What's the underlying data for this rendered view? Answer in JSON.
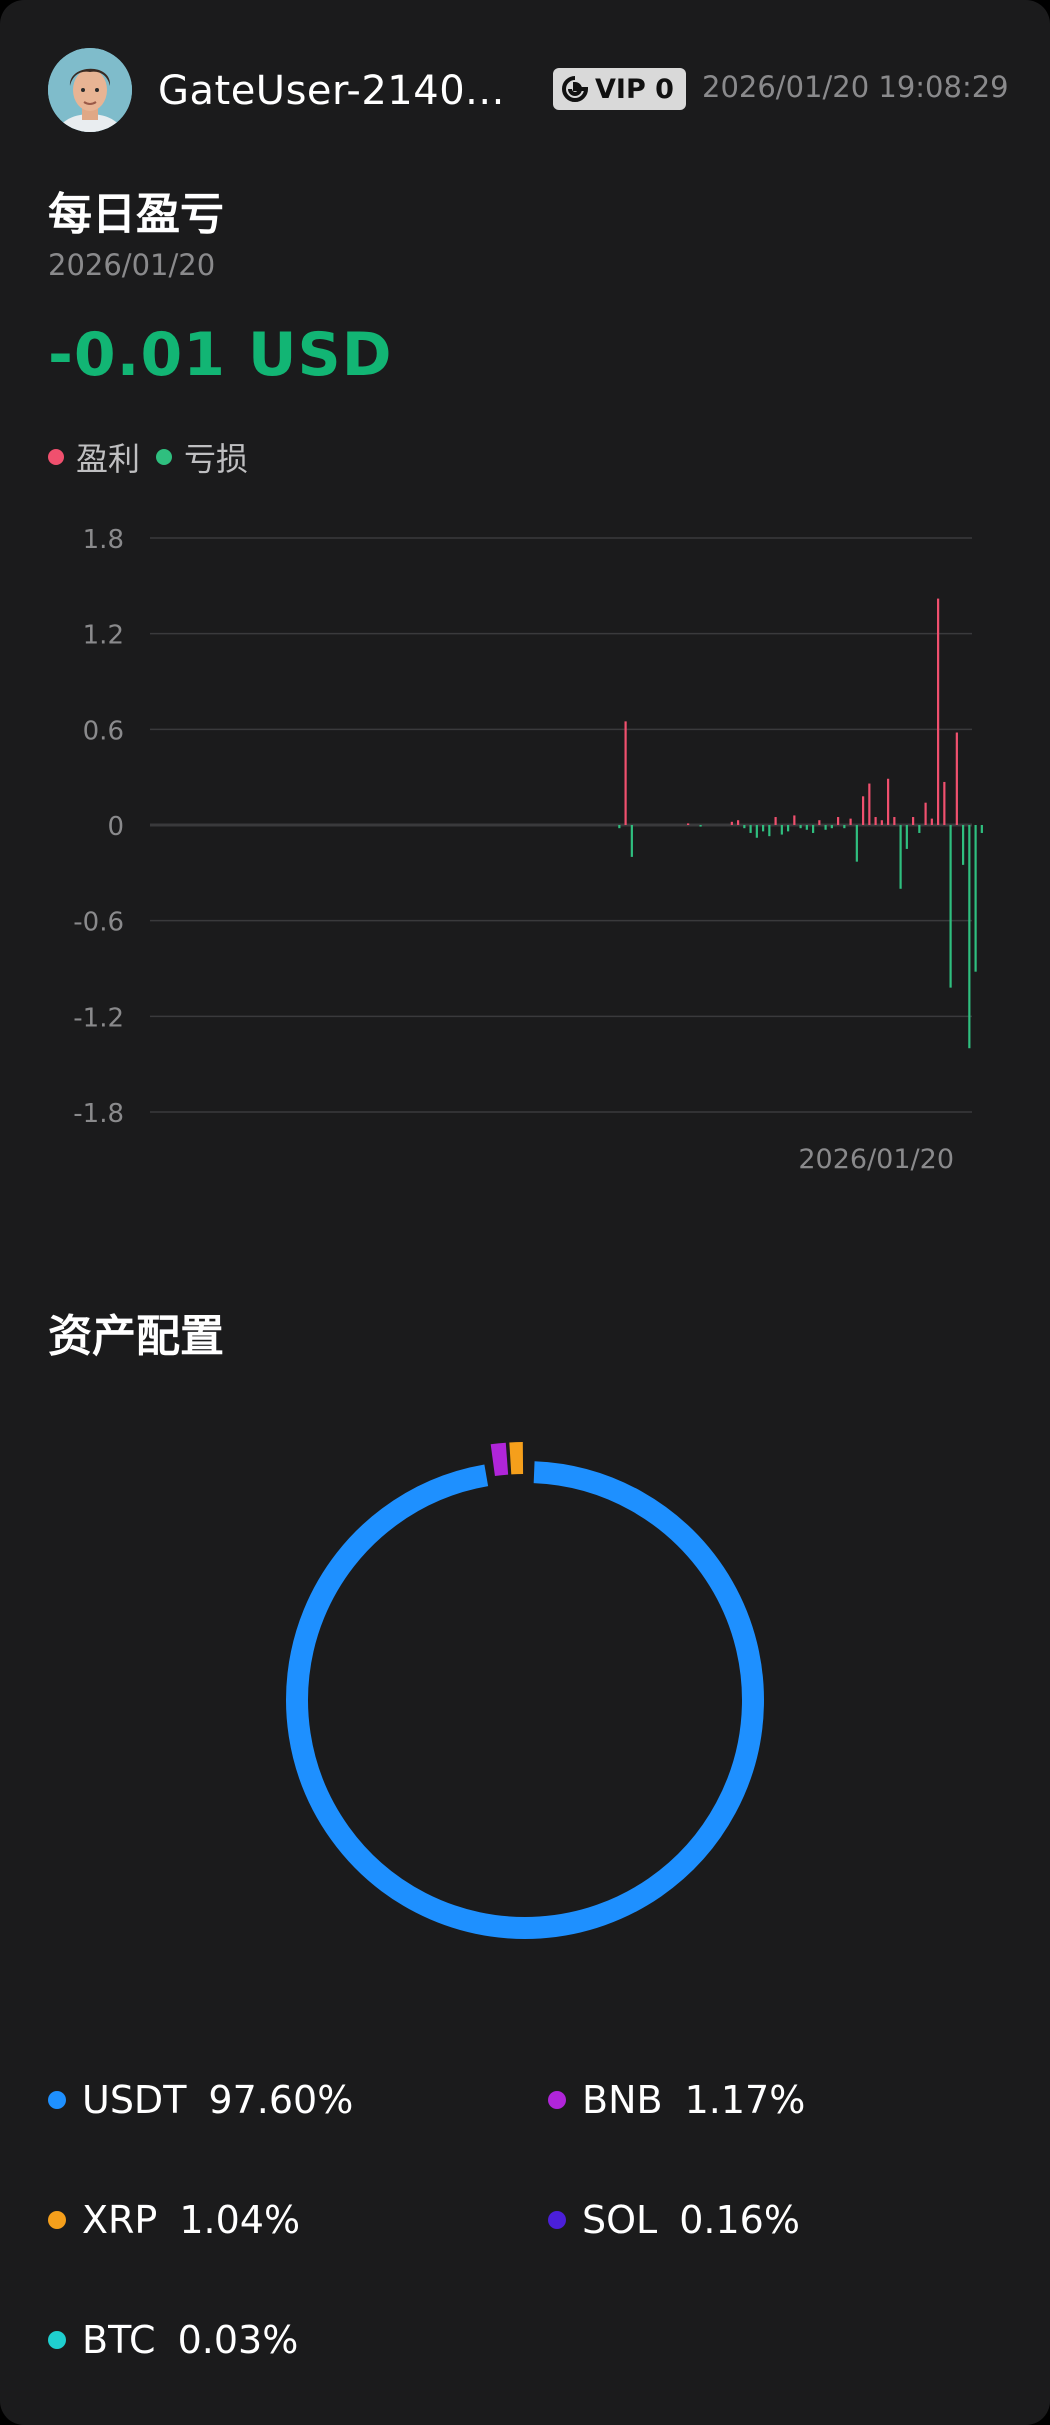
{
  "header": {
    "username": "GateUser-2140...",
    "vip_label": "VIP 0",
    "timestamp": "2026/01/20 19:08:29"
  },
  "daily_pnl": {
    "title": "每日盈亏",
    "date": "2026/01/20",
    "value": "-0.01 USD",
    "legend": {
      "profit": "盈利",
      "loss": "亏损"
    }
  },
  "chart_data": [
    {
      "type": "bar",
      "title": "",
      "xlabel": "",
      "ylabel": "",
      "ylim": [
        -1.8,
        1.8
      ],
      "yticks": [
        "1.8",
        "1.2",
        "0.6",
        "0",
        "-0.6",
        "-1.2",
        "-1.8"
      ],
      "x_tick_labels": [
        "2026/01/20"
      ],
      "grid": true,
      "legend_position": "top-left",
      "colors": {
        "profit": "#f0506e",
        "loss": "#2fbf7f"
      },
      "bars": [
        {
          "x": 1,
          "y": -0.02
        },
        {
          "x": 2,
          "y": 0.65
        },
        {
          "x": 3,
          "y": -0.2
        },
        {
          "x": 12,
          "y": 0.01
        },
        {
          "x": 14,
          "y": -0.01
        },
        {
          "x": 19,
          "y": 0.02
        },
        {
          "x": 20,
          "y": 0.03
        },
        {
          "x": 21,
          "y": -0.02
        },
        {
          "x": 22,
          "y": -0.05
        },
        {
          "x": 23,
          "y": -0.08
        },
        {
          "x": 24,
          "y": -0.04
        },
        {
          "x": 25,
          "y": -0.07
        },
        {
          "x": 26,
          "y": 0.05
        },
        {
          "x": 27,
          "y": -0.06
        },
        {
          "x": 28,
          "y": -0.04
        },
        {
          "x": 29,
          "y": 0.06
        },
        {
          "x": 30,
          "y": -0.02
        },
        {
          "x": 31,
          "y": -0.03
        },
        {
          "x": 32,
          "y": -0.05
        },
        {
          "x": 33,
          "y": 0.03
        },
        {
          "x": 34,
          "y": -0.03
        },
        {
          "x": 35,
          "y": -0.02
        },
        {
          "x": 36,
          "y": 0.05
        },
        {
          "x": 37,
          "y": -0.02
        },
        {
          "x": 38,
          "y": 0.04
        },
        {
          "x": 39,
          "y": -0.23
        },
        {
          "x": 40,
          "y": 0.18
        },
        {
          "x": 41,
          "y": 0.26
        },
        {
          "x": 42,
          "y": 0.05
        },
        {
          "x": 43,
          "y": 0.03
        },
        {
          "x": 44,
          "y": 0.29
        },
        {
          "x": 45,
          "y": 0.05
        },
        {
          "x": 46,
          "y": -0.4
        },
        {
          "x": 47,
          "y": -0.15
        },
        {
          "x": 48,
          "y": 0.05
        },
        {
          "x": 49,
          "y": -0.05
        },
        {
          "x": 50,
          "y": 0.14
        },
        {
          "x": 51,
          "y": 0.04
        },
        {
          "x": 52,
          "y": 1.42
        },
        {
          "x": 53,
          "y": 0.27
        },
        {
          "x": 54,
          "y": -1.02
        },
        {
          "x": 55,
          "y": 0.58
        },
        {
          "x": 56,
          "y": -0.25
        },
        {
          "x": 57,
          "y": -1.4
        },
        {
          "x": 58,
          "y": -0.92
        },
        {
          "x": 59,
          "y": -0.05
        }
      ]
    },
    {
      "type": "pie",
      "title": "资产配置",
      "categories": [
        "USDT",
        "BNB",
        "XRP",
        "SOL",
        "BTC"
      ],
      "values": [
        97.6,
        1.17,
        1.04,
        0.16,
        0.03
      ],
      "colors": [
        "#1e90ff",
        "#b025d9",
        "#f59f1b",
        "#4b1fd9",
        "#1fcfcf"
      ]
    }
  ],
  "allocation": {
    "title": "资产配置",
    "items": [
      {
        "name": "USDT",
        "pct": "97.60%",
        "color": "#1e90ff"
      },
      {
        "name": "BNB",
        "pct": "1.17%",
        "color": "#b025d9"
      },
      {
        "name": "XRP",
        "pct": "1.04%",
        "color": "#f59f1b"
      },
      {
        "name": "SOL",
        "pct": "0.16%",
        "color": "#4b1fd9"
      },
      {
        "name": "BTC",
        "pct": "0.03%",
        "color": "#1fcfcf"
      }
    ]
  },
  "icons": {
    "avatar": "user-avatar",
    "vip": "gate-logo-icon"
  }
}
